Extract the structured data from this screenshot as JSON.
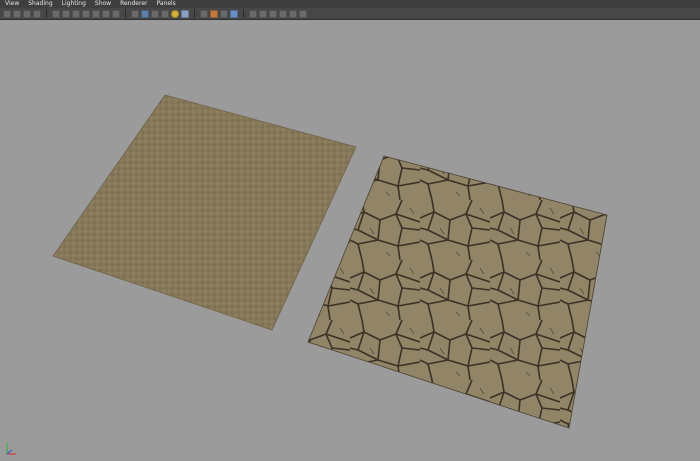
{
  "menu": {
    "view": "View",
    "shading": "Shading",
    "lighting": "Lighting",
    "show": "Show",
    "renderer": "Renderer",
    "panels": "Panels"
  },
  "toolbar": {
    "icons": [
      "select-camera-icon",
      "camera-attributes-icon",
      "bookmark-icon",
      "image-plane-icon",
      "grid-toggle-icon",
      "film-gate-icon",
      "resolution-gate-icon",
      "gate-mask-icon",
      "field-chart-icon",
      "safe-action-icon",
      "safe-title-icon",
      "wireframe-icon",
      "smooth-shade-icon",
      "bounding-box-icon",
      "flat-shade-icon",
      "use-default-material-icon",
      "textured-icon",
      "lights-icon",
      "shadows-icon",
      "xray-icon",
      "xray-joints-icon",
      "isolate-select-icon",
      "high-quality-icon",
      "screen-space-ao-icon",
      "motion-blur-icon",
      "anti-aliasing-icon",
      "depth-of-field-icon"
    ]
  },
  "colors": {
    "viewport_bg": "#9b9b9b",
    "plane_left": "#897a5c",
    "plane_right_base": "#8f8165",
    "crack": "#3a3226"
  }
}
